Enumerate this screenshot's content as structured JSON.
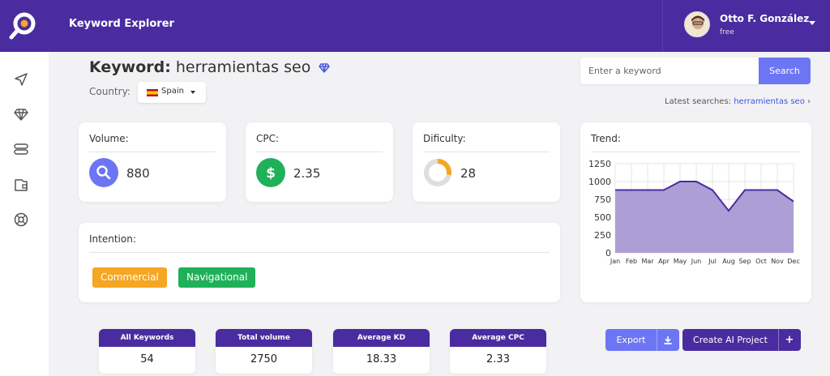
{
  "header": {
    "app_title": "Keyword Explorer",
    "user_name": "Otto F. González",
    "user_plan": "free"
  },
  "sidebar": {
    "icons": [
      "send-icon",
      "diamond-icon",
      "database-icon",
      "wallet-icon",
      "support-icon"
    ]
  },
  "keyword": {
    "label": "Keyword:",
    "value": "herramientas seo",
    "country_label": "Country:",
    "country": "Spain"
  },
  "search": {
    "placeholder": "Enter a keyword",
    "button": "Search",
    "latest_label": "Latest searches:",
    "latest_link": "herramientas seo",
    "latest_arrow": "›"
  },
  "metrics": {
    "volume": {
      "label": "Volume:",
      "value": "880"
    },
    "cpc": {
      "label": "CPC:",
      "value": "2.35"
    },
    "difficulty": {
      "label": "Dificulty:",
      "value": "28",
      "fraction": 0.28
    }
  },
  "intention": {
    "label": "Intention:",
    "tags": [
      "Commercial",
      "Navigational"
    ]
  },
  "trend": {
    "label": "Trend:"
  },
  "chart_data": {
    "type": "area",
    "categories": [
      "Jan",
      "Feb",
      "Mar",
      "Apr",
      "May",
      "Jun",
      "Jul",
      "Aug",
      "Sep",
      "Oct",
      "Nov",
      "Dec"
    ],
    "values": [
      880,
      880,
      880,
      880,
      1000,
      1000,
      880,
      590,
      880,
      880,
      880,
      720
    ],
    "yticks": [
      0,
      250,
      500,
      750,
      1000,
      1250
    ],
    "ylim": [
      0,
      1250
    ],
    "grid": true,
    "fill_color": "#a99ad4",
    "line_color": "#4a2ca0"
  },
  "stats": [
    {
      "label": "All Keywords",
      "value": "54"
    },
    {
      "label": "Total volume",
      "value": "2750"
    },
    {
      "label": "Average KD",
      "value": "18.33"
    },
    {
      "label": "Average CPC",
      "value": "2.33"
    }
  ],
  "actions": {
    "export": "Export",
    "create_project": "Create AI Project",
    "plus": "+"
  },
  "colors": {
    "primary": "#4a2ca0",
    "accent": "#6c76f4",
    "volume": "#6c76f4",
    "cpc": "#1fb15a",
    "difficulty": "#f5a623",
    "commercial": "#f5a623",
    "navigational": "#1fb15a"
  }
}
